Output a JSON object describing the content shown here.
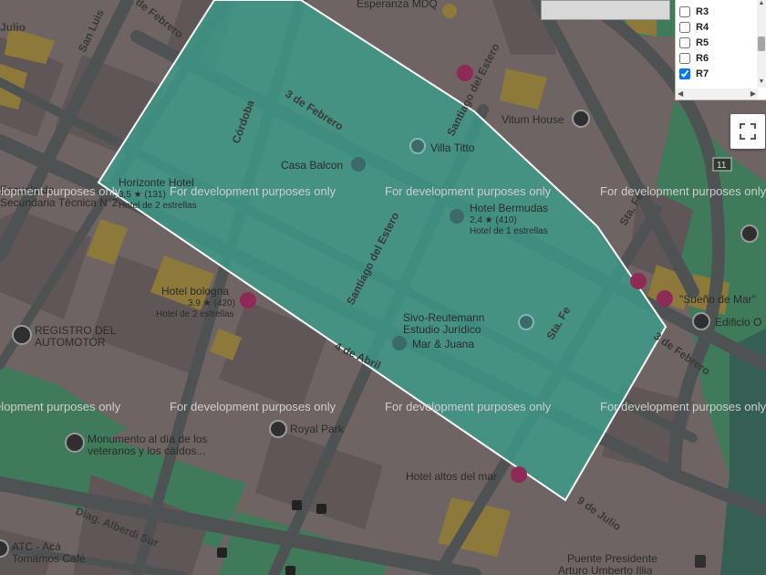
{
  "map": {
    "watermark": "For development purposes only",
    "polygon_fill": "#3a9e8a",
    "polygon_stroke": "#ffffff",
    "streets": {
      "san_luis": "San Luis",
      "tres_febrero": "3 de Febrero",
      "tres_febrero_b": "3 de Febrero",
      "cordoba": "Córdoba",
      "santiago_estero_a": "Santiago del Estero",
      "santiago_estero_b": "Santiago del Estero",
      "sta_fe_a": "Sta. Fe",
      "sta_fe_b": "Sta. Fe",
      "cuatro_abril": "4 de Abril",
      "nueve_julio": "9 de Julio",
      "diag_alberdi": "Diag. Alberdi Sur",
      "febrero_top": "de Febrero",
      "julio_left": "Julio"
    },
    "places": {
      "esperanza": "Esperanza MDQ",
      "vitum": "Vitum House",
      "villa_titto": "Villa Titto",
      "casa_balcon": "Casa Balcon",
      "horizonte": "Horizonte Hotel",
      "horizonte_rating": "3,5 ★ (131)",
      "horizonte_type": "Hotel de 2 estrellas",
      "escuela_a": "Escuela de",
      "escuela_b": "Secundaria Técnica N°2",
      "bermudas": "Hotel Bermudas",
      "bermudas_rating": "2,4 ★ (410)",
      "bermudas_type": "Hotel de 1 estrellas",
      "bologna": "Hotel bologna",
      "bologna_rating": "3,9 ★ (420)",
      "bologna_type": "Hotel de 2 estrellas",
      "registro_a": "REGISTRO DEL",
      "registro_b": "AUTOMOTOR",
      "sivo_a": "Sivo-Reutemann",
      "sivo_b": "Estudio Jurídico",
      "mar_juana": "Mar & Juana",
      "sueno": "\"Sueño de Mar\"",
      "edificio": "Edificio O",
      "royal": "Royal Park",
      "monumento_a": "Monumento al día de los",
      "monumento_b": "veteranos y los caídos...",
      "altos": "Hotel altos del mar",
      "atc_a": "ATC - Acá",
      "atc_b": "Tomamos Café",
      "puente_a": "Puente Presidente",
      "puente_b": "Arturo Umberto Illia",
      "route": "11"
    }
  },
  "layer_panel": {
    "items": [
      {
        "label": "R3",
        "checked": false
      },
      {
        "label": "R4",
        "checked": false
      },
      {
        "label": "R5",
        "checked": false
      },
      {
        "label": "R6",
        "checked": false
      },
      {
        "label": "R7",
        "checked": true
      }
    ]
  },
  "controls": {
    "fullscreen": "fullscreen-icon"
  }
}
